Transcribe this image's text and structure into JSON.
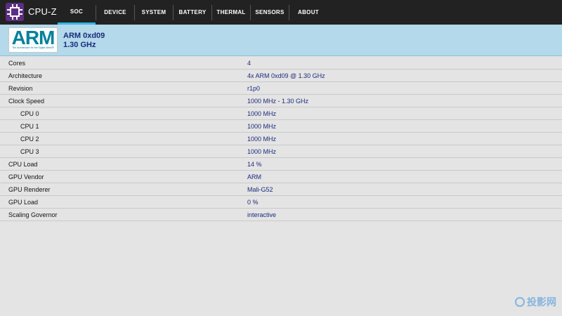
{
  "app": {
    "title": "CPU-Z",
    "icon": "cpu-chip-icon",
    "icon_color": "#5b2d83"
  },
  "tabs": [
    {
      "label": "SOC",
      "active": true
    },
    {
      "label": "DEVICE",
      "active": false
    },
    {
      "label": "SYSTEM",
      "active": false
    },
    {
      "label": "BATTERY",
      "active": false
    },
    {
      "label": "THERMAL",
      "active": false
    },
    {
      "label": "SENSORS",
      "active": false
    },
    {
      "label": "ABOUT",
      "active": false
    }
  ],
  "header": {
    "logo_word": "ARM",
    "logo_tagline": "The Architecture for the Digital World®",
    "line1": "ARM 0xd09",
    "line2": "1.30 GHz"
  },
  "rows": [
    {
      "label": "Cores",
      "value": "4"
    },
    {
      "label": "Architecture",
      "value": "4x ARM 0xd09 @ 1.30 GHz"
    },
    {
      "label": "Revision",
      "value": "r1p0"
    },
    {
      "label": "Clock Speed",
      "value": "1000 MHz - 1.30 GHz"
    },
    {
      "label": "CPU 0",
      "value": "1000 MHz",
      "sub": true
    },
    {
      "label": "CPU 1",
      "value": "1000 MHz",
      "sub": true
    },
    {
      "label": "CPU 2",
      "value": "1000 MHz",
      "sub": true
    },
    {
      "label": "CPU 3",
      "value": "1000 MHz",
      "sub": true
    },
    {
      "label": "CPU Load",
      "value": "14 %"
    },
    {
      "label": "GPU Vendor",
      "value": "ARM"
    },
    {
      "label": "GPU Renderer",
      "value": "Mali-G52"
    },
    {
      "label": "GPU Load",
      "value": "0 %"
    },
    {
      "label": "Scaling Governor",
      "value": "interactive"
    }
  ],
  "watermark": {
    "text": "投影网"
  },
  "colors": {
    "topbar": "#222222",
    "accent": "#33b5e5",
    "header_bg": "#b3d9ea",
    "value_text": "#1a2a7a",
    "arm_brand": "#00809b"
  }
}
